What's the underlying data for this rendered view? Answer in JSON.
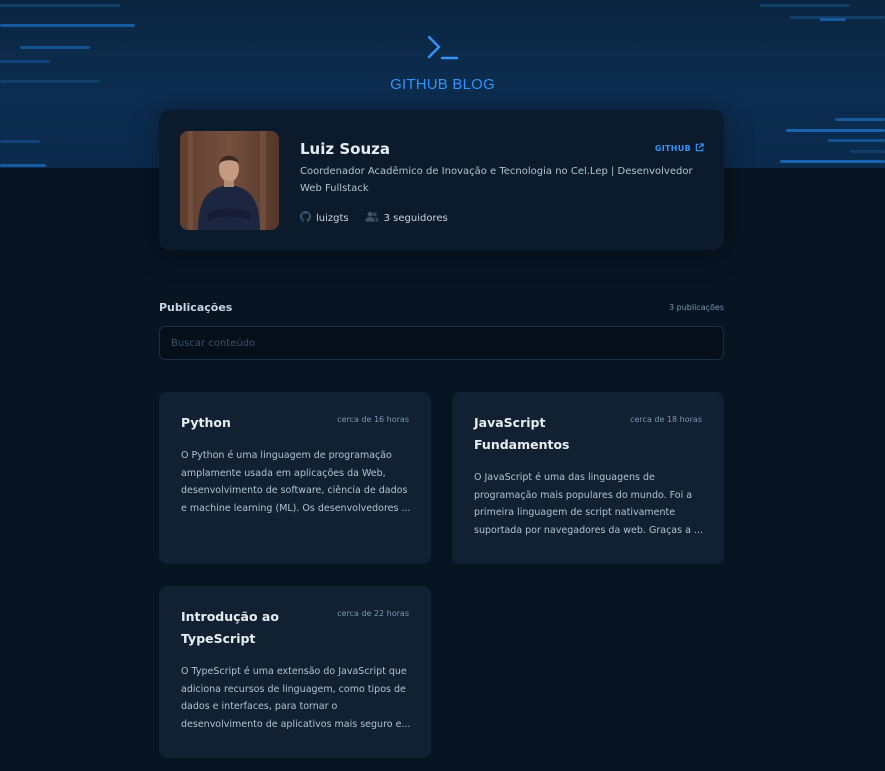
{
  "header": {
    "logo_icon": "terminal-prompt-icon",
    "logo_text": "GITHUB BLOG"
  },
  "profile": {
    "avatar": "profile-photo",
    "name": "Luiz Souza",
    "bio": "Coordenador Acadêmico de Inovação e Tecnologia no Cel.Lep | Desenvolvedor Web Fullstack",
    "github_link": "GITHUB",
    "username": "luizgts",
    "followers": "3 seguidores"
  },
  "publications": {
    "title": "Publicações",
    "count": "3 publicações",
    "search_placeholder": "Buscar conteúdo"
  },
  "posts": [
    {
      "title": "Python",
      "date": "cerca de 16 horas",
      "excerpt": "O Python é uma linguagem de programação amplamente usada em aplicações da Web, desenvolvimento de software, ciência de dados e machine learning (ML). Os desenvolvedores ..."
    },
    {
      "title": "JavaScript Fundamentos",
      "date": "cerca de 18 horas",
      "excerpt": "O JavaScript é uma das linguagens de programação mais populares do mundo. Foi a primeira linguagem de script nativamente suportada por navegadores da web. Graças a ..."
    },
    {
      "title": "Introdução ao TypeScript",
      "date": "cerca de 22 horas",
      "excerpt": "O TypeScript é uma extensão do JavaScript que adiciona recursos de linguagem, como tipos de dados e interfaces, para tornar o desenvolvimento de aplicativos mais seguro e..."
    }
  ],
  "colors": {
    "background": "#071422",
    "header": "#0B2A4C",
    "card": "#112131",
    "profile_card": "#0B1B2B",
    "accent": "#3294F8",
    "title": "#E7EDF4",
    "text": "#AFC2D4",
    "muted": "#7B96B2"
  }
}
